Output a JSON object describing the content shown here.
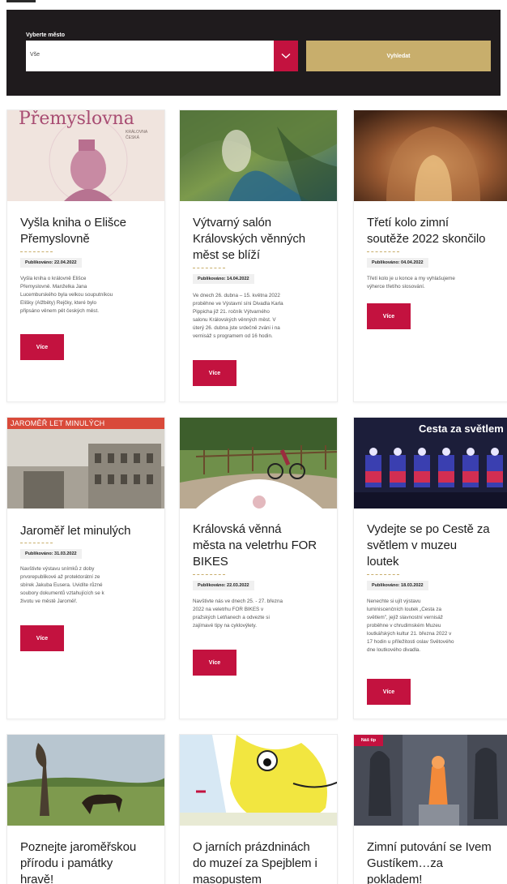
{
  "filter": {
    "label": "Vyberte město",
    "select_value": "Vše",
    "search_label": "Vyhledat"
  },
  "colors": {
    "accent": "#c3123f",
    "gold": "#c8ae6c",
    "dark": "#1f1b1d"
  },
  "cards": [
    {
      "title_lines": [
        "Vyšla kniha o Elišce",
        "Přemyslovně"
      ],
      "published": "Publikováno: 22.04.2022",
      "description_lines": [
        "Vyšla kniha o královně Elišce",
        "Přemyslovně. Manželka Jana",
        "Lucemburského byla velkou souputníkou",
        "Elišky (Alžběty) Rejčky, které bylo",
        "připsáno věnem pět českých měst."
      ],
      "more": "Více",
      "image_text": {
        "big": "Přemyslovna",
        "small_1": "KRÁLOVNA",
        "small_2": "ČESKÁ"
      }
    },
    {
      "title_lines": [
        "Výtvarný salón",
        "Královských věnných",
        "měst se blíží"
      ],
      "published": "Publikováno: 14.04.2022",
      "description_lines": [
        "Ve dnech 26. dubna – 15. května 2022",
        "proběhne ve Výstavní síni Divadla Karla",
        "Pippicha již 21. ročník Výtvarného",
        "salonu Královských věnných měst. V",
        "úterý 26. dubna jste srdečně zváni i na",
        "vernisáž s programem od 16 hodin."
      ],
      "more": "Více"
    },
    {
      "title_lines": [
        "Třetí kolo zimní",
        "soutěže 2022 skončilo"
      ],
      "published": "Publikováno: 04.04.2022",
      "description_lines": [
        "Třetí kolo je u konce a my vyhlašujeme",
        "výherce třetího slosování."
      ],
      "more": "Více"
    },
    {
      "title_lines": [
        "Jaroměř let minulých"
      ],
      "published": "Publikováno: 31.03.2022",
      "description_lines": [
        "Navštivte výstavu snímků z doby",
        "prvorepublikové až protektorátní ze",
        "sbírek Jakuba Eusera. Uvidíte různé",
        "soubory dokumentů vztahujících se k",
        "životu ve městě Jaroměř."
      ],
      "more": "Více",
      "image_text": {
        "big": "JAROMĚŘ LET MINULÝCH"
      }
    },
    {
      "title_lines": [
        "Královská věnná",
        "města na veletrhu FOR",
        "BIKES"
      ],
      "published": "Publikováno: 22.03.2022",
      "description_lines": [
        "Navštivte nás ve dnech 25. - 27. března",
        "2022 na veletrhu FOR BIKES v",
        "pražských Letňanech a odvezte si",
        "zajímavé tipy na cyklovýlety."
      ],
      "more": "Více"
    },
    {
      "title_lines": [
        "Vydejte se po Cestě za",
        "světlem v muzeu",
        "loutek"
      ],
      "published": "Publikováno: 18.03.2022",
      "description_lines": [
        "Nenechte si ujít výstavu",
        "luminiscenčních loutek „Cesta za",
        "světlem\", jejíž slavnostní vernisáž",
        "proběhne v chrudimském Muzeu",
        "loutkářských kultur 21. března 2022 v",
        "17 hodin u příležitosti oslav Světového",
        "dne loutkového divadla."
      ],
      "more": "Více",
      "image_text": {
        "big": "Cesta za světlem"
      }
    },
    {
      "title_lines": [
        "Poznejte jaroměřskou",
        "přírodu i památky",
        "hravě!"
      ]
    },
    {
      "title_lines": [
        "O jarních prázdninách",
        "do muzeí za Spejblem i",
        "masopustem"
      ]
    },
    {
      "title_lines": [
        "Zimní putování se Ivem",
        "Gustíkem…za",
        "pokladem!"
      ],
      "badge": "Náš tip"
    }
  ]
}
